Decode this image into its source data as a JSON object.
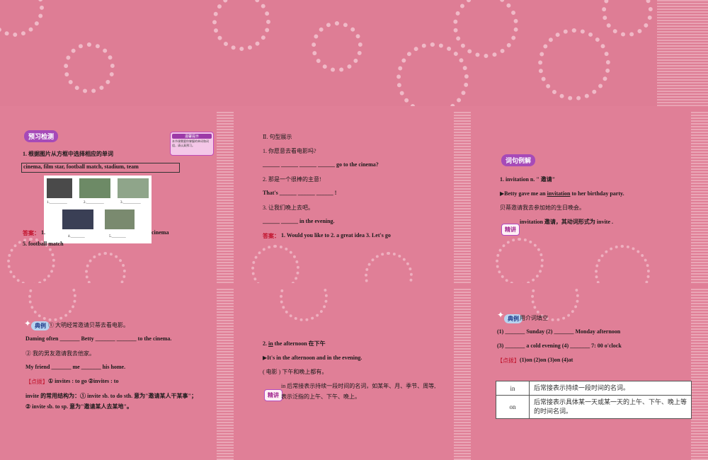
{
  "slide1": {
    "badge": "预习检测",
    "note_title": "温馨提示",
    "note_text": "本节课需要你掌握的单词和词组，请认真预习。",
    "q1": "1. 根据图片从方框中选择相应的单词",
    "words": "cinema,  film star,  football match,  stadium,  team",
    "photo_labels": [
      "1.__________",
      "2.__________",
      "3.__________",
      "4.________",
      "5.________"
    ],
    "answer_label": "答案：",
    "answer_prefix": "1.",
    "answer_tail": "cinema",
    "answer_line2": "5. football match"
  },
  "slide2": {
    "heading": "Ⅱ. 句型展示",
    "q1": "1. 你愿意去看电影吗?",
    "q1_en": "______ ______ ______ ______ go to the cinema?",
    "q2": "2. 那是一个很棒的主意!",
    "q2_en": "That's ______ ______ ______ !",
    "q3": "3. 让我们晚上去吧。",
    "q3_en": "______ ______ in the evening.",
    "answer_label": "答案：",
    "answer": "1. Would you like to    2. a great idea    3. Let's go"
  },
  "slide3": {
    "badge": "词句例解",
    "l1": "1. invitation n. \" 邀请\"",
    "l2_pre": "▶Betty gave me an ",
    "l2_u": "invitation",
    "l2_post": " to her birthday party.",
    "l3": "贝蒂邀请我去参加她的生日晚会。",
    "jingjiang": "精讲",
    "l4": "invitation  邀请，其动词形式为 invite ."
  },
  "slide4": {
    "example_badge": "典例",
    "l1": "① 大明经常邀请贝蒂去看电影。",
    "l2": "Daming often _______ Betty _______ _______  to the cinema.",
    "l3": "② 我的男友邀请我去他家。",
    "l4": "My friend _______ me _______ his home.",
    "dianbo": "【点拨】",
    "l5": "① invites :    to go          ②invites :    to",
    "l6": "invite 的常用结构为：① invite sb. to do sth.  意为\"邀请某人干某事\"；",
    "l7": "② invite sb. to sp.  意为\"邀请某人去某地\"。"
  },
  "slide5": {
    "l1_pre": "2. ",
    "l1_u": "in",
    "l1_post": " the afternoon  在下午",
    "l2": "▶It's in the afternoon and in the evening.",
    "l3": "( 电影 ) 下午和晚上都有。",
    "jingjiang": "精讲",
    "l4": "in  后常接表示持续一段时间的名词，如某年、月、季节、周等,",
    "l5": "表示泛指的上午、下午、晚上。"
  },
  "slide6": {
    "example_badge": "典例",
    "l1": "用介词填空",
    "l2": "(1) _______ Sunday       (2) _______ Monday afternoon",
    "l3": "(3) _______ a cold evening      (4) _______ 7: 00 o'clock",
    "dianbo": "【点拨】",
    "l4": "(1)on      (2)on      (3)on      (4)at",
    "table": [
      {
        "k": "in",
        "v": "后常接表示持续一段时间的名词。"
      },
      {
        "k": "on",
        "v": "后常接表示具体某一天或某一天的上午、下午、晚上等的时间名词。"
      }
    ]
  }
}
